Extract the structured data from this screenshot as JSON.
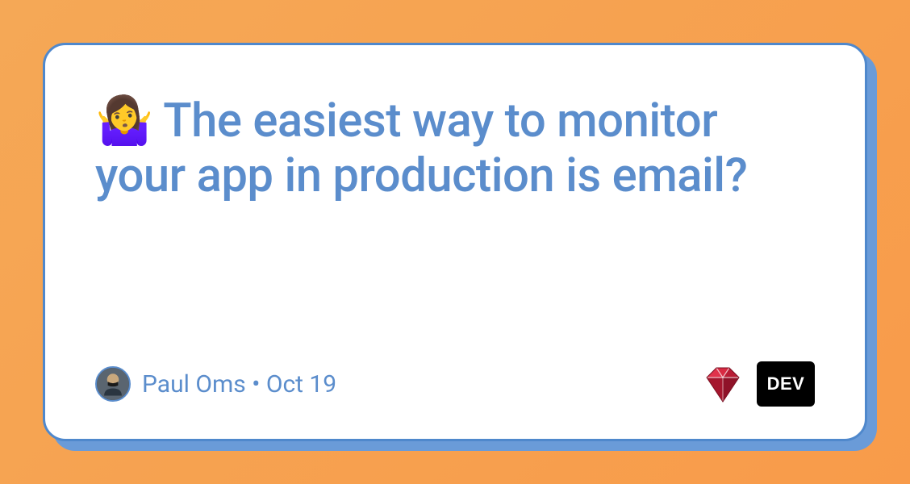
{
  "card": {
    "title_emoji": "🤷‍♀️",
    "title": "The easiest way to monitor your app in production is email?"
  },
  "author": {
    "name": "Paul Oms",
    "date": "Oct 19",
    "separator": "•"
  },
  "logos": {
    "ruby": "ruby-logo",
    "dev": "DEV"
  }
}
